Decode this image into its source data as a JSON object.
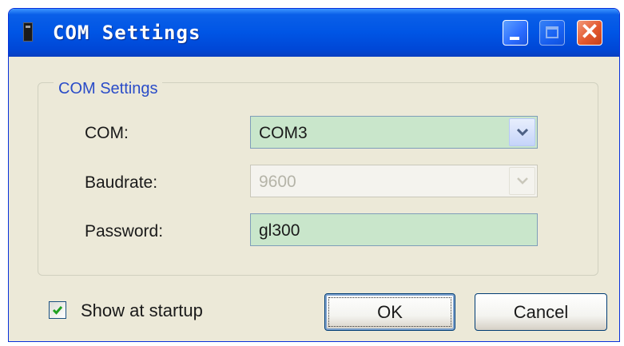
{
  "window": {
    "title": "COM Settings",
    "controls": {
      "minimize": "minimize-icon",
      "maximize": "maximize-icon",
      "close": "close-icon",
      "close_glyph": "✕"
    },
    "accent_color": "#0055e5",
    "close_color": "#e2582e"
  },
  "group": {
    "legend": "COM Settings",
    "legend_color": "#2a4cc8",
    "fields": {
      "com": {
        "label": "COM:",
        "value": "COM3",
        "enabled": true
      },
      "baudrate": {
        "label": "Baudrate:",
        "value": "9600",
        "enabled": false
      },
      "password": {
        "label": "Password:",
        "value": "gl300"
      }
    },
    "field_bg_color": "#c9e6cb"
  },
  "footer": {
    "show_at_startup": {
      "label": "Show at startup",
      "checked": true,
      "check_color": "#21a121"
    },
    "ok_label": "OK",
    "cancel_label": "Cancel"
  }
}
